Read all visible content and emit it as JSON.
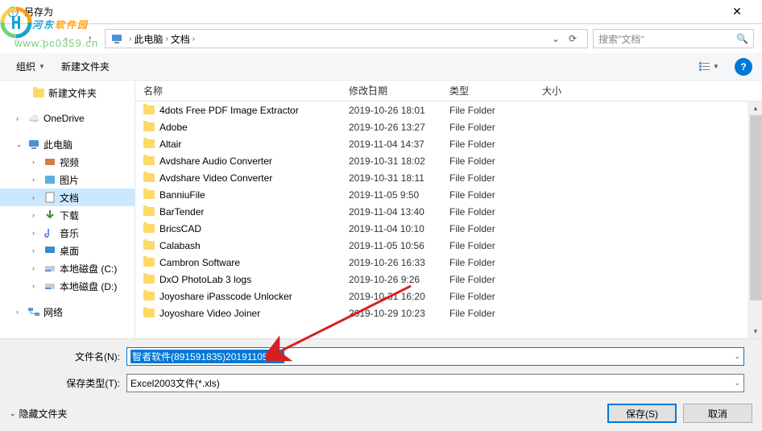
{
  "title": "另存为",
  "watermark": {
    "brand_a": "河东",
    "brand_b": "软件园",
    "url": "www.pc0359.cn"
  },
  "breadcrumb": {
    "root": "此电脑",
    "folder": "文档"
  },
  "search": {
    "placeholder": "搜索\"文档\""
  },
  "toolbar": {
    "organize": "组织",
    "new_folder": "新建文件夹"
  },
  "columns": {
    "name": "名称",
    "date": "修改日期",
    "type": "类型",
    "size": "大小"
  },
  "sidebar": {
    "new_folder": "新建文件夹",
    "onedrive": "OneDrive",
    "this_pc": "此电脑",
    "videos": "视频",
    "pictures": "图片",
    "documents": "文档",
    "downloads": "下载",
    "music": "音乐",
    "desktop": "桌面",
    "disk_c": "本地磁盘 (C:)",
    "disk_d": "本地磁盘 (D:)",
    "network": "网络"
  },
  "files": [
    {
      "name": "4dots Free PDF Image Extractor",
      "date": "2019-10-26 18:01",
      "type": "File Folder"
    },
    {
      "name": "Adobe",
      "date": "2019-10-26 13:27",
      "type": "File Folder"
    },
    {
      "name": "Altair",
      "date": "2019-11-04 14:37",
      "type": "File Folder"
    },
    {
      "name": "Avdshare Audio Converter",
      "date": "2019-10-31 18:02",
      "type": "File Folder"
    },
    {
      "name": "Avdshare Video Converter",
      "date": "2019-10-31 18:11",
      "type": "File Folder"
    },
    {
      "name": "BanniuFile",
      "date": "2019-11-05 9:50",
      "type": "File Folder"
    },
    {
      "name": "BarTender",
      "date": "2019-11-04 13:40",
      "type": "File Folder"
    },
    {
      "name": "BricsCAD",
      "date": "2019-11-04 10:10",
      "type": "File Folder"
    },
    {
      "name": "Calabash",
      "date": "2019-11-05 10:56",
      "type": "File Folder"
    },
    {
      "name": "Cambron Software",
      "date": "2019-10-26 16:33",
      "type": "File Folder"
    },
    {
      "name": "DxO PhotoLab 3 logs",
      "date": "2019-10-26 9:26",
      "type": "File Folder"
    },
    {
      "name": "Joyoshare iPasscode Unlocker",
      "date": "2019-10-31 16:20",
      "type": "File Folder"
    },
    {
      "name": "Joyoshare Video Joiner",
      "date": "2019-10-29 10:23",
      "type": "File Folder"
    }
  ],
  "filename": {
    "label": "文件名(N):",
    "value": "智者软件(891591835)20191105.xls"
  },
  "filetype": {
    "label": "保存类型(T):",
    "value": "Excel2003文件(*.xls)"
  },
  "buttons": {
    "hide": "隐藏文件夹",
    "save": "保存(S)",
    "cancel": "取消"
  }
}
